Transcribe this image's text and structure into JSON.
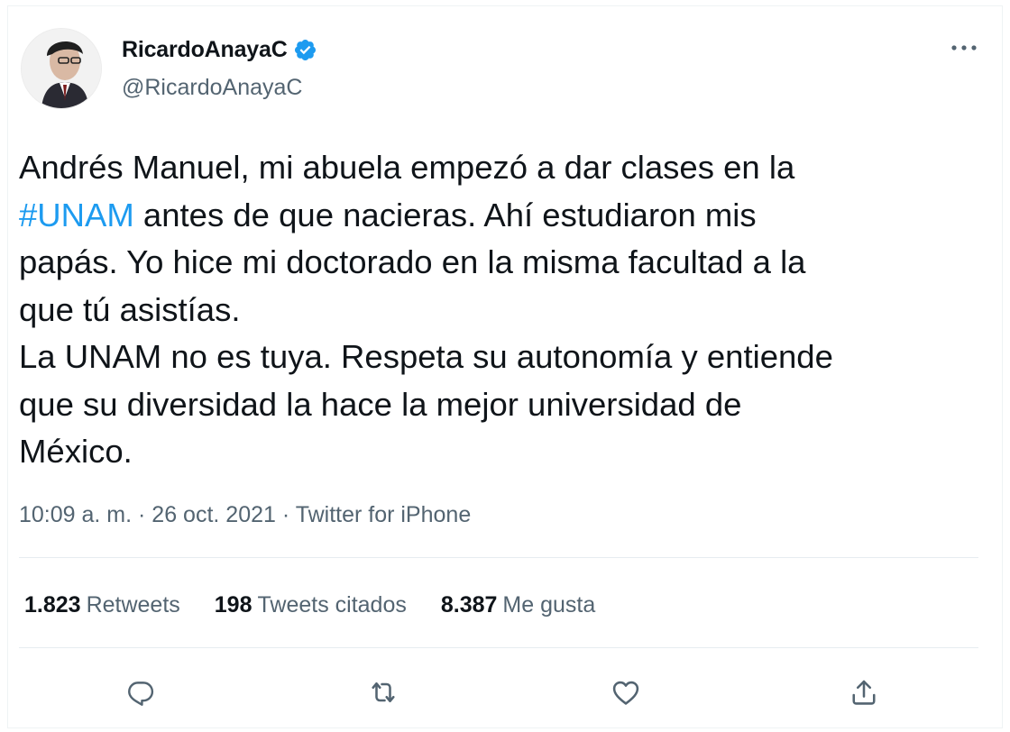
{
  "author": {
    "display_name": "RicardoAnayaC",
    "handle": "@RicardoAnayaC",
    "verified_icon": "verified-badge-icon"
  },
  "tweet": {
    "line1": "Andrés Manuel, mi abuela empezó a dar clases en la",
    "hashtag": "#UNAM",
    "line2_rest": " antes de que nacieras. Ahí estudiaron mis",
    "line3": "papás. Yo hice mi doctorado en la misma facultad a la",
    "line4": "que tú asistías.",
    "line5": "La UNAM no es tuya. Respeta su autonomía y entiende",
    "line6": "que su diversidad la hace la mejor universidad de",
    "line7": "México."
  },
  "meta": {
    "time": "10:09 a. m.",
    "separator": " · ",
    "date": "26 oct. 2021",
    "source": "Twitter for iPhone"
  },
  "stats": {
    "retweets_count": "1.823",
    "retweets_label": "Retweets",
    "quotes_count": "198",
    "quotes_label": "Tweets citados",
    "likes_count": "8.387",
    "likes_label": "Me gusta"
  },
  "colors": {
    "accent": "#1d9bf0",
    "text": "#0f1419",
    "secondary": "#536471"
  },
  "icons": [
    "more-icon",
    "reply-icon",
    "retweet-icon",
    "like-icon",
    "share-icon"
  ]
}
